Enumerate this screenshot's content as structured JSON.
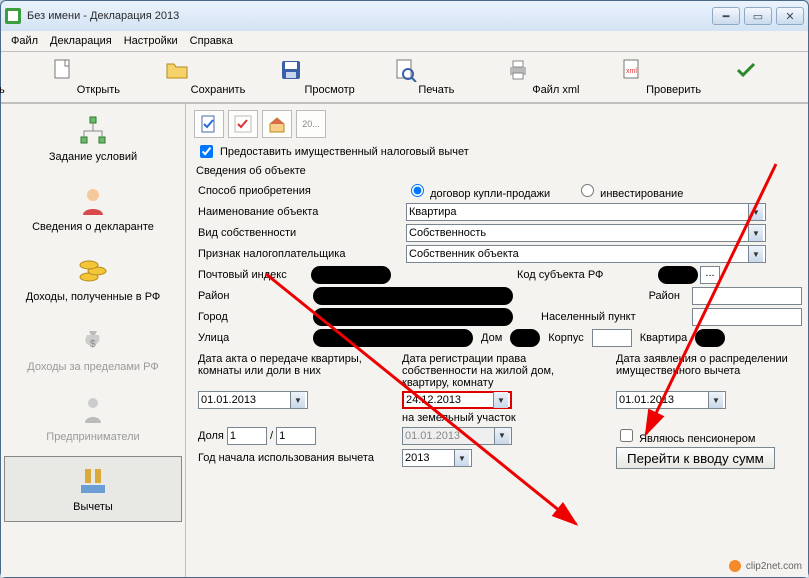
{
  "window": {
    "title": "Без имени - Декларация 2013"
  },
  "menu": {
    "file": "Файл",
    "declaration": "Декларация",
    "settings": "Настройки",
    "help": "Справка"
  },
  "toolbar": {
    "create": "Создать",
    "open": "Открыть",
    "save": "Сохранить",
    "preview": "Просмотр",
    "print": "Печать",
    "filexml": "Файл xml",
    "check": "Проверить"
  },
  "sidebar": {
    "conditions": "Задание условий",
    "declarant": "Сведения о декларанте",
    "income_rf": "Доходы, полученные в РФ",
    "income_abroad": "Доходы за пределами РФ",
    "entrepreneurs": "Предприниматели",
    "deductions": "Вычеты"
  },
  "form": {
    "provide_checkbox": "Предоставить имущественный налоговый вычет",
    "object_info": "Сведения об объекте",
    "acq_method": "Способ приобретения",
    "radio_buy": "договор купли-продажи",
    "radio_invest": "инвестирование",
    "object_name": "Наименование объекта",
    "object_name_val": "Квартира",
    "ownership": "Вид собственности",
    "ownership_val": "Собственность",
    "taxpayer_sign": "Признак налогоплательщика",
    "taxpayer_val": "Собственник объекта",
    "postal": "Почтовый индекс",
    "region_code": "Код субъекта РФ",
    "district": "Район",
    "city": "Город",
    "locality": "Населенный пункт",
    "street": "Улица",
    "house": "Дом",
    "block": "Корпус",
    "flat": "Квартира",
    "col1_label": "Дата акта о передаче квартиры, комнаты или доли в них",
    "col2_label": "Дата регистрации права собственности на жилой дом, квартиру, комнату",
    "col3_label": "Дата заявления о распределении имущественного вычета",
    "date1": "01.01.2013",
    "date2": "24.12.2013",
    "land_label": "на земельный участок",
    "date_land": "01.01.2013",
    "date3": "01.01.2013",
    "share_label": "Доля",
    "share_num": "1",
    "share_slash": "/",
    "share_den": "1",
    "pensioner": "Являюсь пенсионером",
    "start_year_label": "Год начала использования вычета",
    "start_year": "2013",
    "goto_btn": "Перейти к вводу сумм"
  },
  "watermark": "clip2net.com",
  "mini_doc": "20..."
}
